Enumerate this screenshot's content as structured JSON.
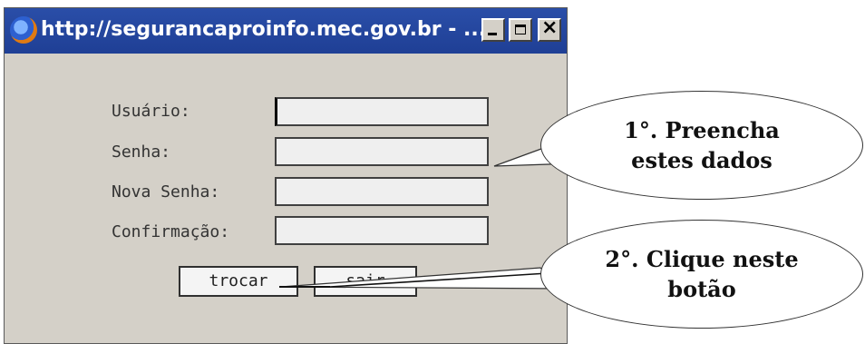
{
  "window": {
    "title": "http://segurancaproinfo.mec.gov.br - ...",
    "icon": "firefox-icon",
    "controls": [
      "minimize-icon",
      "maximize-icon",
      "close-icon"
    ]
  },
  "form": {
    "fields": [
      {
        "label": "Usuário:",
        "value": ""
      },
      {
        "label": "Senha:",
        "value": ""
      },
      {
        "label": "Nova Senha:",
        "value": ""
      },
      {
        "label": "Confirmação:",
        "value": ""
      }
    ],
    "buttons": {
      "change_label": "trocar",
      "other_label": "sair"
    }
  },
  "callouts": {
    "first": {
      "line1": "1°. Preencha",
      "line2": "estes dados"
    },
    "second": {
      "line1": "2°. Clique neste",
      "line2": "botão"
    }
  },
  "colors": {
    "titlebar": "#1f3f95",
    "window_bg": "#d4d0c8"
  }
}
